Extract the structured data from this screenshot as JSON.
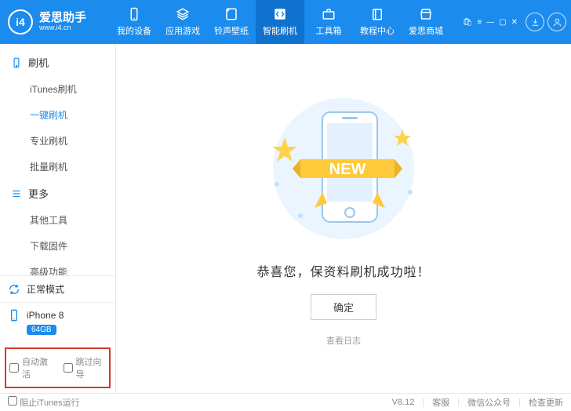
{
  "brand": {
    "logo_text": "i4",
    "name_cn": "爱思助手",
    "name_en": "www.i4.cn"
  },
  "nav": [
    {
      "label": "我的设备",
      "icon": "phone"
    },
    {
      "label": "应用游戏",
      "icon": "app"
    },
    {
      "label": "铃声壁纸",
      "icon": "note"
    },
    {
      "label": "智能刷机",
      "icon": "arrows",
      "active": true
    },
    {
      "label": "工具箱",
      "icon": "case"
    },
    {
      "label": "教程中心",
      "icon": "book"
    },
    {
      "label": "爱思商城",
      "icon": "shop"
    }
  ],
  "sidebar": {
    "sections": [
      {
        "title": "刷机",
        "icon": "phone",
        "items": [
          {
            "label": "iTunes刷机"
          },
          {
            "label": "一键刷机",
            "active": true
          },
          {
            "label": "专业刷机"
          },
          {
            "label": "批量刷机"
          }
        ]
      },
      {
        "title": "更多",
        "icon": "list",
        "items": [
          {
            "label": "其他工具"
          },
          {
            "label": "下载固件"
          },
          {
            "label": "高级功能"
          }
        ]
      }
    ],
    "status": {
      "label": "正常模式"
    },
    "device": {
      "name": "iPhone 8",
      "badge": "64GB"
    },
    "checks": {
      "auto_activate": "自动激活",
      "skip_guide": "跳过向导"
    }
  },
  "main": {
    "ribbon_text": "NEW",
    "message": "恭喜您，保资料刷机成功啦！",
    "ok": "确定",
    "log": "查看日志"
  },
  "footer": {
    "block_itunes": "阻止iTunes运行",
    "version": "V8.12",
    "links": [
      "客服",
      "微信公众号",
      "检查更新"
    ]
  }
}
